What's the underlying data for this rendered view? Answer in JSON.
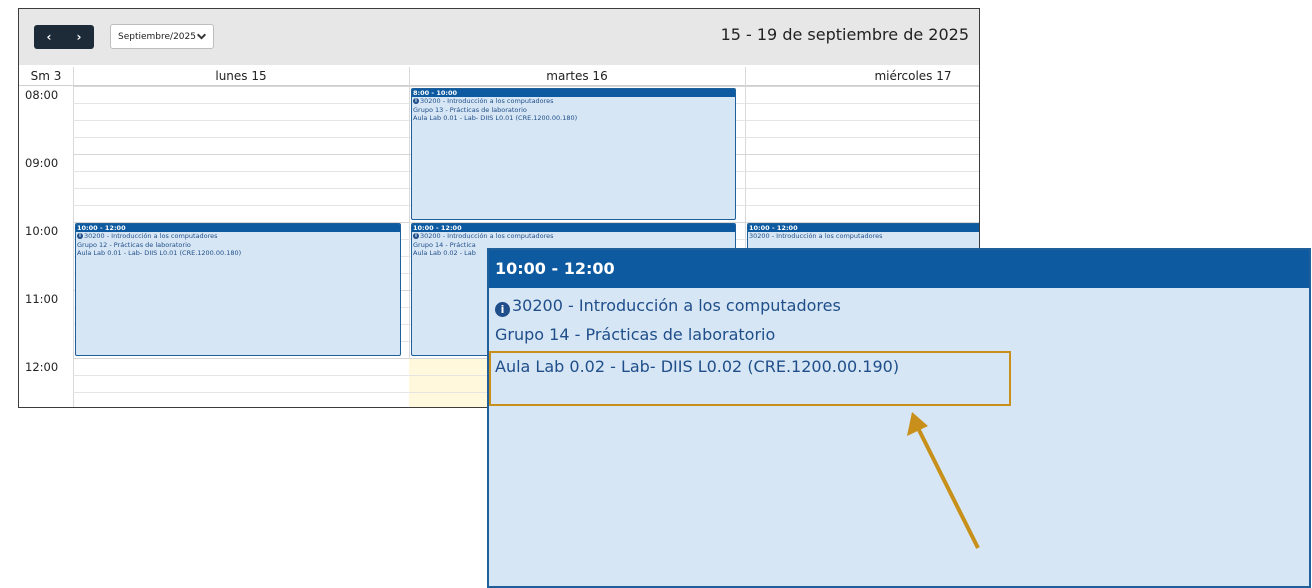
{
  "calendar": {
    "nav": {
      "prev": "‹",
      "next": "›"
    },
    "month_select": "Septiembre/2025",
    "range_title": "15 - 19 de septiembre de 2025",
    "week_label": "Sm 3",
    "days": [
      "lunes 15",
      "martes 16",
      "miércoles 17"
    ],
    "hours": [
      "08:00",
      "09:00",
      "10:00",
      "11:00",
      "12:00"
    ],
    "events": [
      {
        "time": "8:00 - 10:00",
        "course": "30200 - Introducción a los computadores",
        "group": "Grupo 13 - Prácticas de laboratorio",
        "room": "Aula Lab 0.01 - Lab- DIIS L0.01 (CRE.1200.00.180)"
      },
      {
        "time": "10:00 - 12:00",
        "course": "30200 - Introducción a los computadores",
        "group": "Grupo 12 - Prácticas de laboratorio",
        "room": "Aula Lab 0.01 - Lab- DIIS L0.01 (CRE.1200.00.180)"
      },
      {
        "time": "10:00 - 12:00",
        "course": "30200 - Introducción a los computadores",
        "group": "Grupo 14 - Práctica",
        "room": "Aula Lab 0.02 - Lab"
      },
      {
        "time": "10:00 - 12:00",
        "course": "30200 - Introducción a los computadores"
      }
    ]
  },
  "zoom": {
    "time": "10:00 - 12:00",
    "course": "30200 - Introducción a los computadores",
    "group": "Grupo 14 - Prácticas de laboratorio",
    "room": "Aula Lab 0.02 - Lab- DIIS L0.02 (CRE.1200.00.190)"
  },
  "colors": {
    "event_header": "#0d5aa0",
    "event_bg": "#d6e6f4",
    "highlight": "#c8901a",
    "nav_dark": "#1d2a38"
  }
}
